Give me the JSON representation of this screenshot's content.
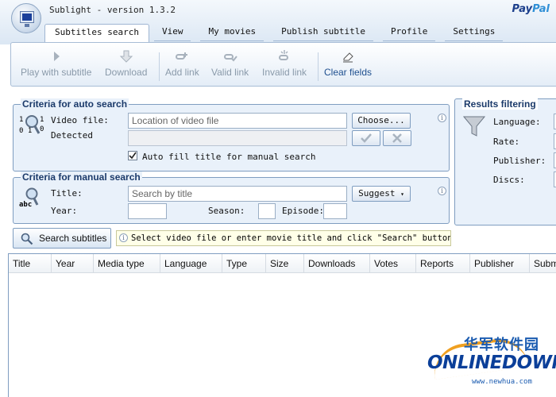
{
  "app": {
    "title": "Sublight - version 1.3.2",
    "paypal_pay": "Pay",
    "paypal_pal": "Pal"
  },
  "tabs": [
    {
      "label": "Subtitles search",
      "active": true
    },
    {
      "label": "View"
    },
    {
      "label": "My movies"
    },
    {
      "label": "Publish subtitle"
    },
    {
      "label": "Profile"
    },
    {
      "label": "Settings"
    }
  ],
  "toolbar": {
    "play": "Play with subtitle",
    "download": "Download",
    "add_link": "Add link",
    "valid_link": "Valid link",
    "invalid_link": "Invalid link",
    "clear": "Clear fields"
  },
  "auto": {
    "title": "Criteria for auto search",
    "video_label": "Video file:",
    "video_placeholder": "Location of video file",
    "choose": "Choose...",
    "detected_label": "Detected",
    "autofill": "Auto fill title for manual search",
    "binary_1": "1",
    "binary_2": "1",
    "binary_3": "0 1",
    "binary_4": "0"
  },
  "manual": {
    "title": "Criteria for manual search",
    "title_label": "Title:",
    "title_placeholder": "Search by title",
    "suggest": "Suggest",
    "year_label": "Year:",
    "season_label": "Season:",
    "episode_label": "Episode:",
    "abc": "abc"
  },
  "filter": {
    "title": "Results filtering",
    "language": "Language:",
    "rate": "Rate:",
    "publisher": "Publisher:",
    "discs": "Discs:"
  },
  "search": {
    "button": "Search subtitles",
    "hint": "Select video file or enter movie title and click \"Search\" button."
  },
  "grid": {
    "columns": [
      "Title",
      "Year",
      "Media type",
      "Language",
      "Type",
      "Size",
      "Downloads",
      "Votes",
      "Reports",
      "Publisher",
      "Submi"
    ]
  },
  "watermark": {
    "cn": "华军软件园",
    "logo_a": "ONLINE",
    "logo_b": "DOWN",
    "url": "www.newhua.com"
  }
}
